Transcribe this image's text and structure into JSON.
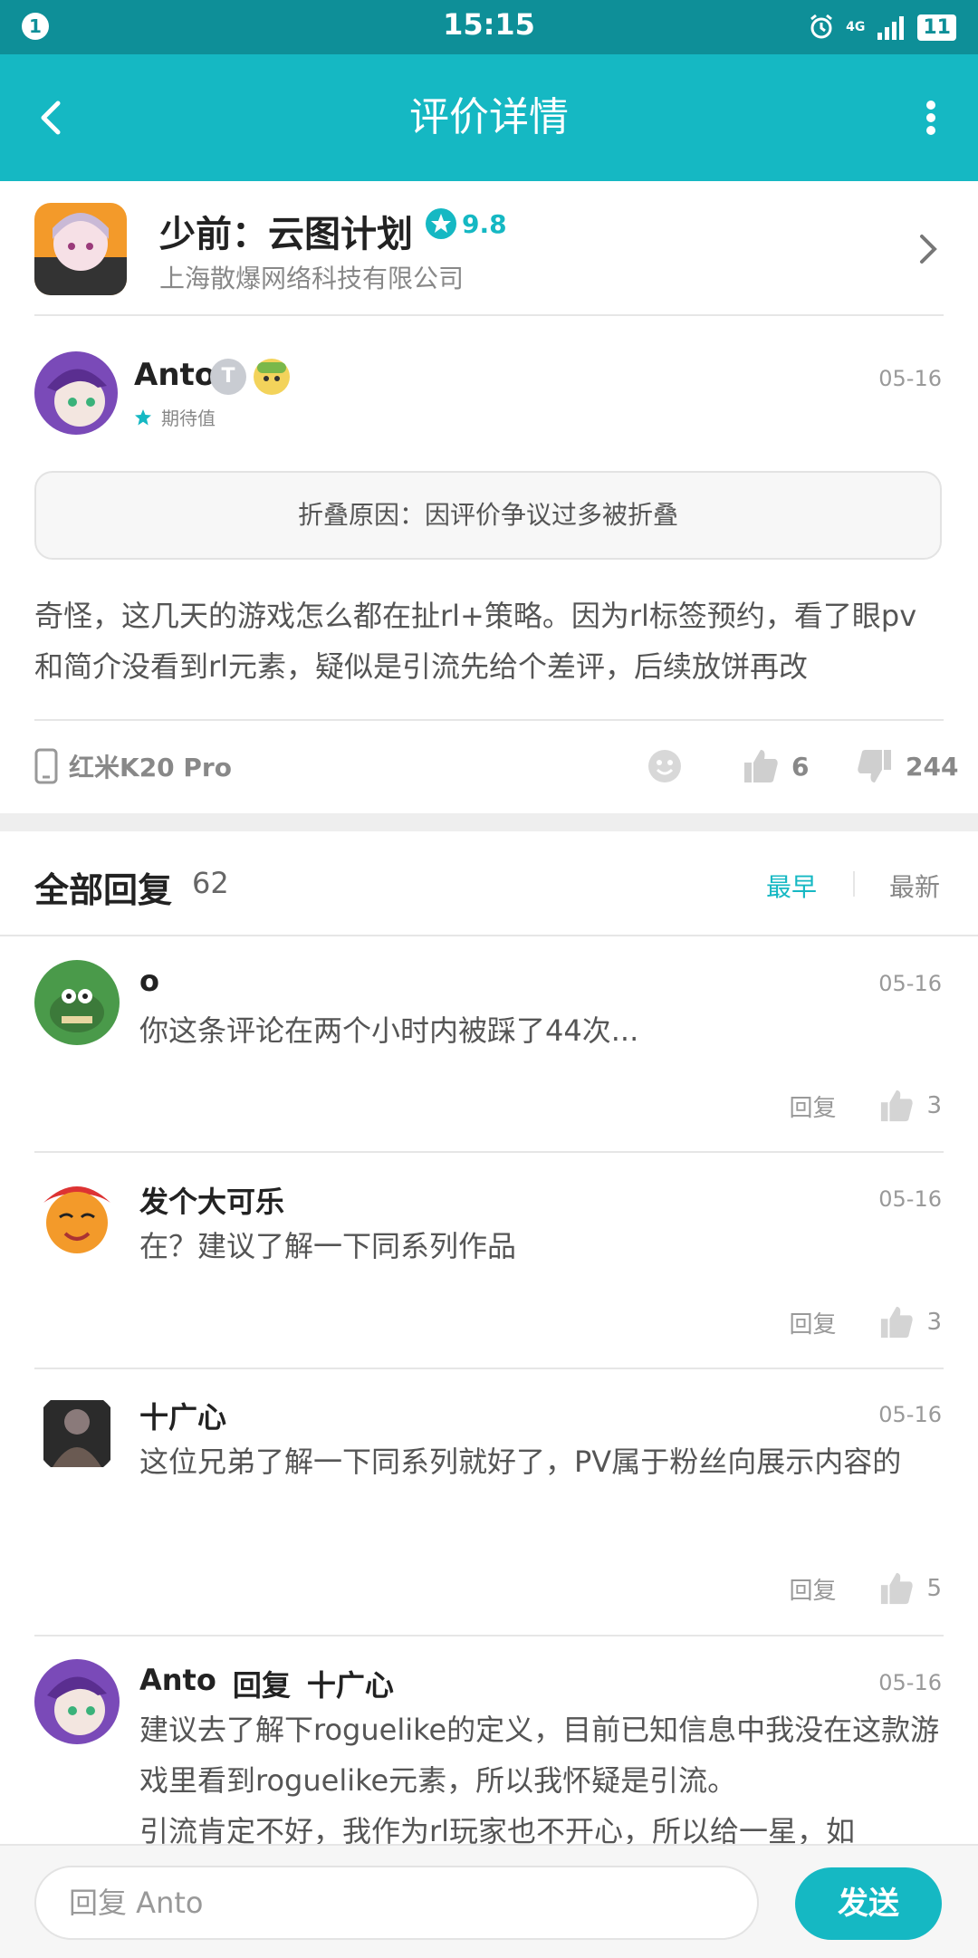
{
  "status_bar": {
    "notification": "1",
    "time": "15:15",
    "network": "4G",
    "battery": "11"
  },
  "app_bar": {
    "title": "评价详情"
  },
  "game": {
    "title": "少前：云图计划",
    "rating": "9.8",
    "company": "上海散爆网络科技有限公司"
  },
  "review": {
    "author": "Anto",
    "badge": "T",
    "expect_label": "期待值",
    "date": "05-16",
    "fold_reason": "折叠原因：因评价争议过多被折叠",
    "content": "奇怪，这几天的游戏怎么都在扯rl+策略。因为rl标签预约，看了眼pv和简介没看到rl元素，疑似是引流先给个差评，后续放饼再改",
    "device": "红米K20 Pro",
    "likes": "6",
    "dislikes": "244"
  },
  "replies_header": {
    "title": "全部回复",
    "count": "62",
    "sort_earliest": "最早",
    "sort_latest": "最新"
  },
  "replies": [
    {
      "name": "o",
      "date": "05-16",
      "text": "你这条评论在两个小时内被踩了44次...",
      "reply_label": "回复",
      "likes": "3"
    },
    {
      "name": "发个大可乐",
      "date": "05-16",
      "text": "在？建议了解一下同系列作品",
      "reply_label": "回复",
      "likes": "3"
    },
    {
      "name": "十广心",
      "date": "05-16",
      "text": "这位兄弟了解一下同系列就好了，PV属于粉丝向展示内容的",
      "reply_label": "回复",
      "likes": "5"
    },
    {
      "name": "Anto",
      "reply_word": "回复",
      "reply_to": "十广心",
      "date": "05-16",
      "text": "建议去了解下roguelike的定义，目前已知信息中我没在这款游戏里看到roguelike元素，所以我怀疑是引流。",
      "text2": "引流肯定不好，我作为rl玩家也不开心，所以给一星，如"
    }
  ],
  "bottom_bar": {
    "placeholder": "回复 Anto",
    "send_label": "发送"
  },
  "colors": {
    "accent": "#15b8c3",
    "status_bar": "#0e8f98"
  }
}
